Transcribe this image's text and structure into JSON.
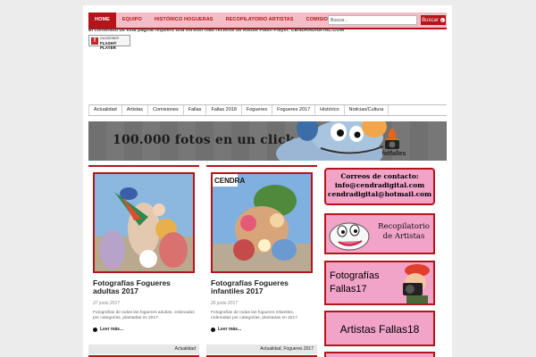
{
  "topnav": {
    "items": [
      "HOME",
      "EQUIPO",
      "HISTÓRICO HOGUERAS",
      "RECOPILATORIO ARTISTAS",
      "COMISIONES"
    ],
    "search_placeholder": "Buscar...",
    "search_button": "Buscar"
  },
  "flash": {
    "message": "El contenido de esta página requiere una versión más reciente de Adobe Flash Player. CENDRADIGITAL.COM",
    "badge_logo": "f",
    "badge_small": "Get ADOBE®",
    "badge_big": "FLASH® PLAYER"
  },
  "catnav": {
    "items": [
      "Actualidad",
      "Artistas",
      "Comisiones",
      "Fallas",
      "Fallas 2018",
      "Fogueres",
      "Fogueres 2017",
      "Histórico",
      "Noticias/Cultura"
    ]
  },
  "banner": {
    "text": "100.000 fotos en un click",
    "logo_text": "fotfalles"
  },
  "posts": [
    {
      "title": "Fotografías Fogueres adultas 2017",
      "date": "27 junio 2017",
      "excerpt": "Fotografías de todas las fogueres adultas, ordenadas por categorías, plantadas en 2017.",
      "more": "Leer más...",
      "category": "Actualidad"
    },
    {
      "title": "Fotografías Fogueres infantiles 2017",
      "date": "26 junio 2017",
      "excerpt": "Fotografías de todas las fogueres infantiles, ordenadas por categorías, plantadas en 2017.",
      "more": "Leer más...",
      "category": "Actualidad, Fogueres 2017"
    }
  ],
  "sidebar": {
    "contact_title": "Correos de contacto:",
    "contact_email_1": "info@cendradigital.com",
    "contact_email_2": "cendradigital@hotmail.com",
    "recopilatorio_line1": "Recopilatorio",
    "recopilatorio_line2": "de Artistas",
    "fotografias_line1": "Fotografías",
    "fotografias_line2": "Fallas17",
    "artistas": "Artistas Fallas18"
  },
  "colors": {
    "brand_red": "#b5141b",
    "nav_pink": "#f4bcc4",
    "sidebar_pink": "#f1a3c8"
  }
}
